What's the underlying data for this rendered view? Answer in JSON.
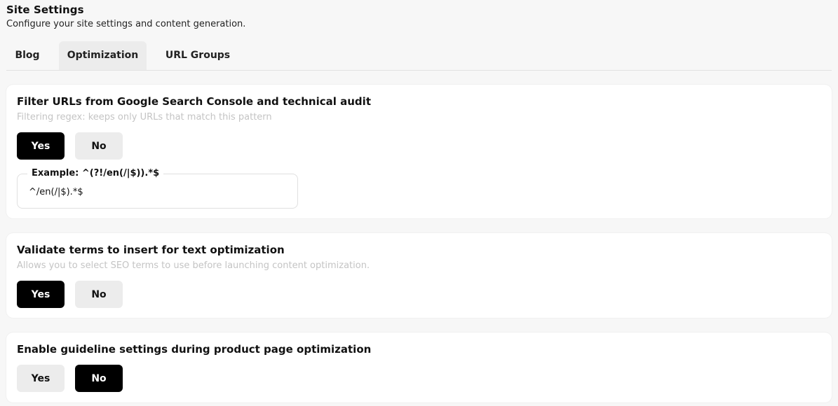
{
  "header": {
    "title": "Site Settings",
    "subtitle": "Configure your site settings and content generation."
  },
  "tabs": [
    {
      "label": "Blog",
      "active": false
    },
    {
      "label": "Optimization",
      "active": true
    },
    {
      "label": "URL Groups",
      "active": false
    }
  ],
  "filter_urls": {
    "title": "Filter URLs from Google Search Console and technical audit",
    "description": "Filtering regex: keeps only URLs that match this pattern",
    "yes_label": "Yes",
    "no_label": "No",
    "selected": "Yes",
    "regex_legend": "Example: ^(?!/en(/|$)).*$",
    "regex_value": "^/en(/|$).*$"
  },
  "validate_terms": {
    "title": "Validate terms to insert for text optimization",
    "description": "Allows you to select SEO terms to use before launching content optimization.",
    "yes_label": "Yes",
    "no_label": "No",
    "selected": "Yes"
  },
  "guideline_settings": {
    "title": "Enable guideline settings during product page optimization",
    "yes_label": "Yes",
    "no_label": "No",
    "selected": "No"
  },
  "colors": {
    "selected_bg": "#000000",
    "unselected_bg": "#ececec",
    "page_bg": "#f7f7f7",
    "card_bg": "#ffffff",
    "muted_text": "#c4c4c4"
  }
}
